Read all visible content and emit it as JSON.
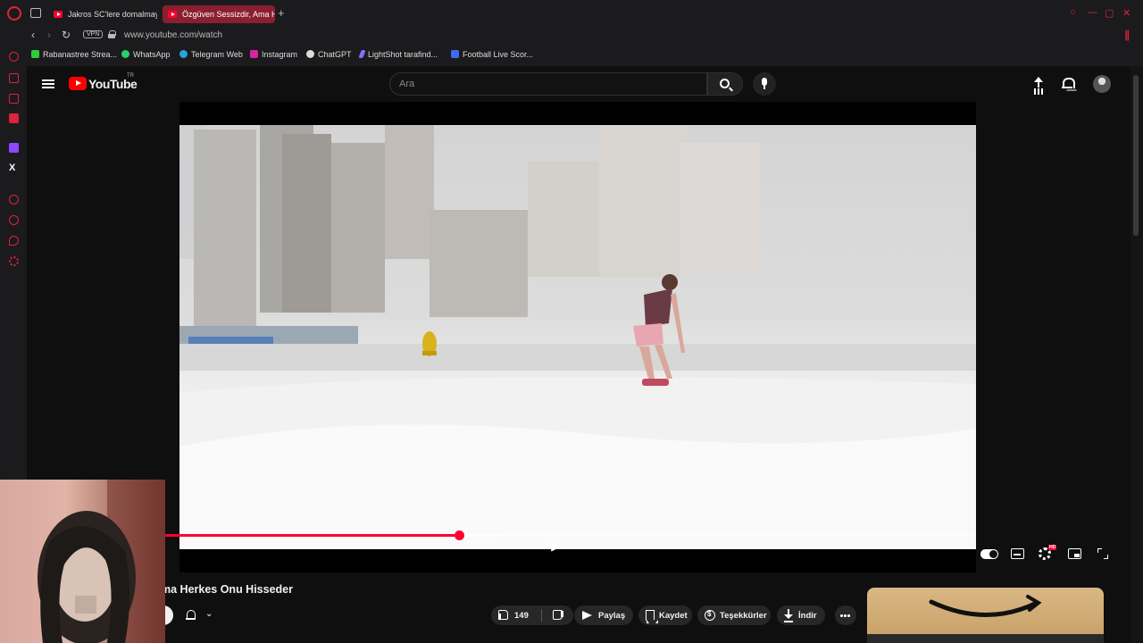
{
  "browser": {
    "tabs": [
      {
        "label": "Jakros SC'lere domalmaya",
        "active": false
      },
      {
        "label": "Özgüven Sessizdir, Ama H",
        "active": true
      }
    ],
    "new_tab": "+",
    "vpn_badge": "VPN",
    "url": "www.youtube.com/watch",
    "bookmarks": [
      {
        "label": "Rabanastree Strea...",
        "icon": "green-r-icon",
        "color": "#2ecc40"
      },
      {
        "label": "WhatsApp",
        "icon": "whatsapp-icon",
        "color": "#25d366"
      },
      {
        "label": "Telegram Web",
        "icon": "telegram-icon",
        "color": "#2aa3df"
      },
      {
        "label": "Instagram",
        "icon": "instagram-icon",
        "color": "#d6249f"
      },
      {
        "label": "ChatGPT",
        "icon": "chatgpt-icon",
        "color": "#dddddd"
      },
      {
        "label": "LightShot tarafind...",
        "icon": "lightshot-feather-icon",
        "color": "#8a6dff"
      },
      {
        "label": "Football Live Scor...",
        "icon": "football-icon",
        "color": "#3a6df0"
      }
    ],
    "accent_color": "#e0223a"
  },
  "youtube": {
    "logo_text": "YouTube",
    "country_code": "TR",
    "search_placeholder": "Ara",
    "player": {
      "progress_played_fraction": 0.352,
      "progress_buffered_fraction": 0.405,
      "progress_color": "#ff0033"
    },
    "video_title": "ma Herkes Onu Hisseder",
    "actions": {
      "like_count": "149",
      "share_label": "Paylaş",
      "save_label": "Kaydet",
      "thanks_label": "Teşekkürler",
      "download_label": "İndir"
    }
  }
}
